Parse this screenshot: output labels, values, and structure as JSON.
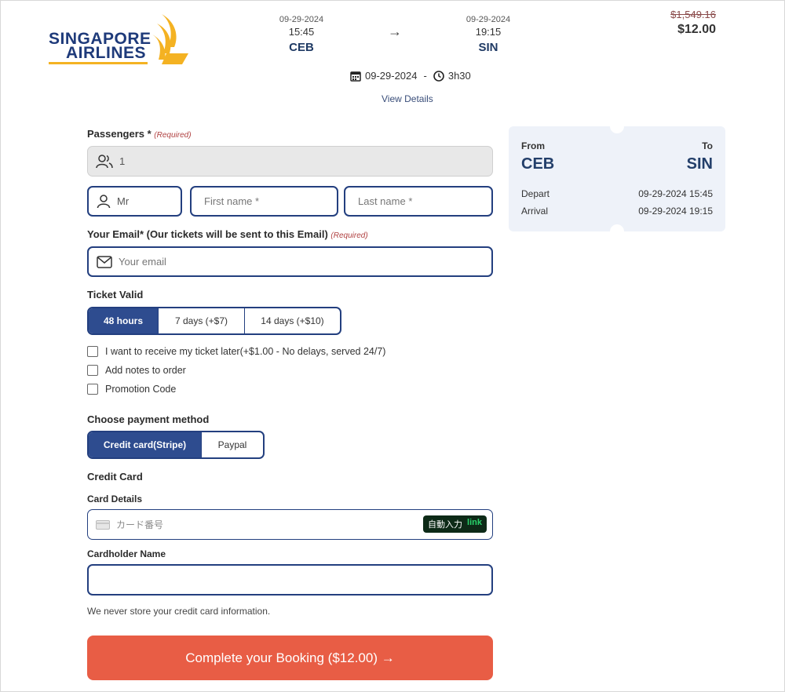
{
  "brand": {
    "line1": "SINGAPORE",
    "line2": "AIRLINES"
  },
  "flight": {
    "depart": {
      "date": "09-29-2024",
      "time": "15:45",
      "code": "CEB"
    },
    "arrive": {
      "date": "09-29-2024",
      "time": "19:15",
      "code": "SIN"
    },
    "arrow": "→",
    "date": "09-29-2024",
    "separator": "-",
    "duration": "3h30",
    "view_details": "View Details"
  },
  "price": {
    "original": "$1,549.16",
    "current": "$12.00"
  },
  "form": {
    "passengers_label": "Passengers *",
    "required": "(Required)",
    "passengers_value": "1",
    "title_value": "Mr",
    "first_name_placeholder": "First name *",
    "last_name_placeholder": "Last name *",
    "email_label": "Your Email* (Our tickets will be sent to this Email)",
    "email_placeholder": "Your email",
    "ticket_valid_label": "Ticket Valid",
    "ticket_options": [
      "48 hours",
      "7 days (+$7)",
      "14 days (+$10)"
    ],
    "checkboxes": [
      "I want to receive my ticket later(+$1.00 - No delays, served 24/7)",
      "Add notes to order",
      "Promotion Code"
    ],
    "payment_label": "Choose payment method",
    "payment_options": [
      "Credit card(Stripe)",
      "Paypal"
    ],
    "credit_card_heading": "Credit Card",
    "card_details_label": "Card Details",
    "card_number_placeholder": "カード番号",
    "autofill_label": "自動入力",
    "autofill_link": "link",
    "cardholder_label": "Cardholder Name",
    "cardholder_value": "",
    "disclaimer": "We never store your credit card information.",
    "submit": "Complete your Booking ($12.00) →"
  },
  "summary": {
    "from_label": "From",
    "to_label": "To",
    "from_code": "CEB",
    "to_code": "SIN",
    "depart_label": "Depart",
    "depart_value": "09-29-2024 15:45",
    "arrival_label": "Arrival",
    "arrival_value": "09-29-2024 19:15"
  },
  "colors": {
    "primary": "#2e4c8f",
    "accent": "#e85d45",
    "brand_gold": "#f4b222"
  }
}
